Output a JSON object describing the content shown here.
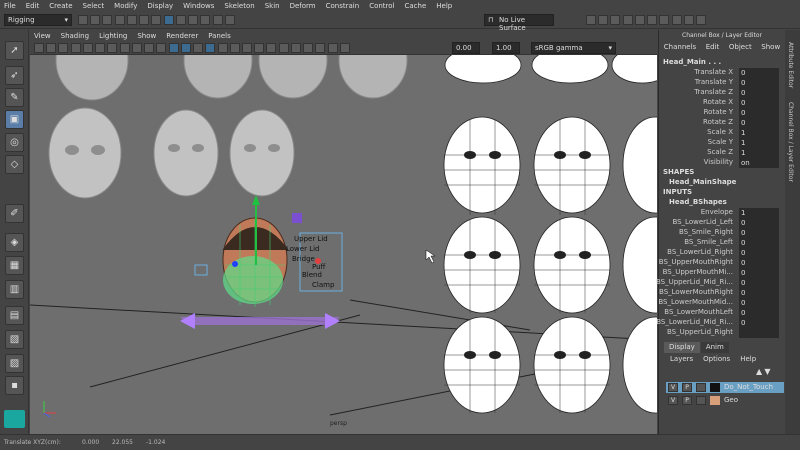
{
  "menubar": [
    "File",
    "Edit",
    "Create",
    "Select",
    "Modify",
    "Display",
    "Windows",
    "Skeleton",
    "Skin",
    "Deform",
    "Constrain",
    "Control",
    "Cache",
    "Help"
  ],
  "status": {
    "mode": "Rigging",
    "live_surface": "No Live Surface"
  },
  "viewport": {
    "menu": [
      "View",
      "Shading",
      "Lighting",
      "Show",
      "Renderer",
      "Panels"
    ],
    "field1": "0.00",
    "field2": "1.00",
    "colorspace": "sRGB gamma",
    "camera": "persp",
    "overlay_text": [
      "Upper Lid",
      "Lower Lid",
      "Bridge",
      "Puff",
      "Blend",
      "Clamp"
    ]
  },
  "channelbox": {
    "title": "Channel Box / Layer Editor",
    "menu": [
      "Channels",
      "Edit",
      "Object",
      "Show"
    ],
    "object": "Head_Main . . .",
    "attrs": [
      {
        "name": "Translate X",
        "value": "0"
      },
      {
        "name": "Translate Y",
        "value": "0"
      },
      {
        "name": "Translate Z",
        "value": "0"
      },
      {
        "name": "Rotate X",
        "value": "0"
      },
      {
        "name": "Rotate Y",
        "value": "0"
      },
      {
        "name": "Rotate Z",
        "value": "0"
      },
      {
        "name": "Scale X",
        "value": "1"
      },
      {
        "name": "Scale Y",
        "value": "1"
      },
      {
        "name": "Scale Z",
        "value": "1"
      },
      {
        "name": "Visibility",
        "value": "on"
      }
    ],
    "shapes_label": "SHAPES",
    "shape_name": "Head_MainShape",
    "inputs_label": "INPUTS",
    "input_name": "Head_BShapes",
    "blend_attrs": [
      {
        "name": "Envelope",
        "value": "1"
      },
      {
        "name": "BS_LowerLid_Left",
        "value": "0"
      },
      {
        "name": "BS_Smile_Right",
        "value": "0"
      },
      {
        "name": "BS_Smile_Left",
        "value": "0"
      },
      {
        "name": "BS_LowerLid_Right",
        "value": "0"
      },
      {
        "name": "BS_UpperMouthRight",
        "value": "0"
      },
      {
        "name": "BS_UpperMouthMi...",
        "value": "0"
      },
      {
        "name": "BS_UpperLid_Mid_Ri...",
        "value": "0"
      },
      {
        "name": "BS_LowerMouthRight",
        "value": "0"
      },
      {
        "name": "BS_LowerMouthMid...",
        "value": "0"
      },
      {
        "name": "BS_LowerMouthLeft",
        "value": "0"
      },
      {
        "name": "BS_LowerLid_Mid_Ri...",
        "value": "0"
      },
      {
        "name": "BS_UpperLid_Right",
        "value": ""
      }
    ],
    "side_tabs": [
      "Attribute Editor",
      "Channel Box / Layer Editor"
    ]
  },
  "layers": {
    "tabs": [
      "Display",
      "Anim"
    ],
    "menu": [
      "Layers",
      "Options",
      "Help"
    ],
    "rows": [
      {
        "v": "V",
        "p": "P",
        "name": "Do_Not_Touch",
        "color": "#111111",
        "selected": true
      },
      {
        "v": "V",
        "p": "P",
        "name": "Geo",
        "color": "#d7a07a",
        "selected": false
      }
    ]
  },
  "helpline": {
    "label": "Translate XYZ(cm):",
    "x": "0.000",
    "y": "22.055",
    "z": "-1.024"
  },
  "colors": {
    "accent": "#5a7ea8",
    "viewport_bg": "#6e6e6e",
    "selected_layer": "#6a9fc4"
  }
}
